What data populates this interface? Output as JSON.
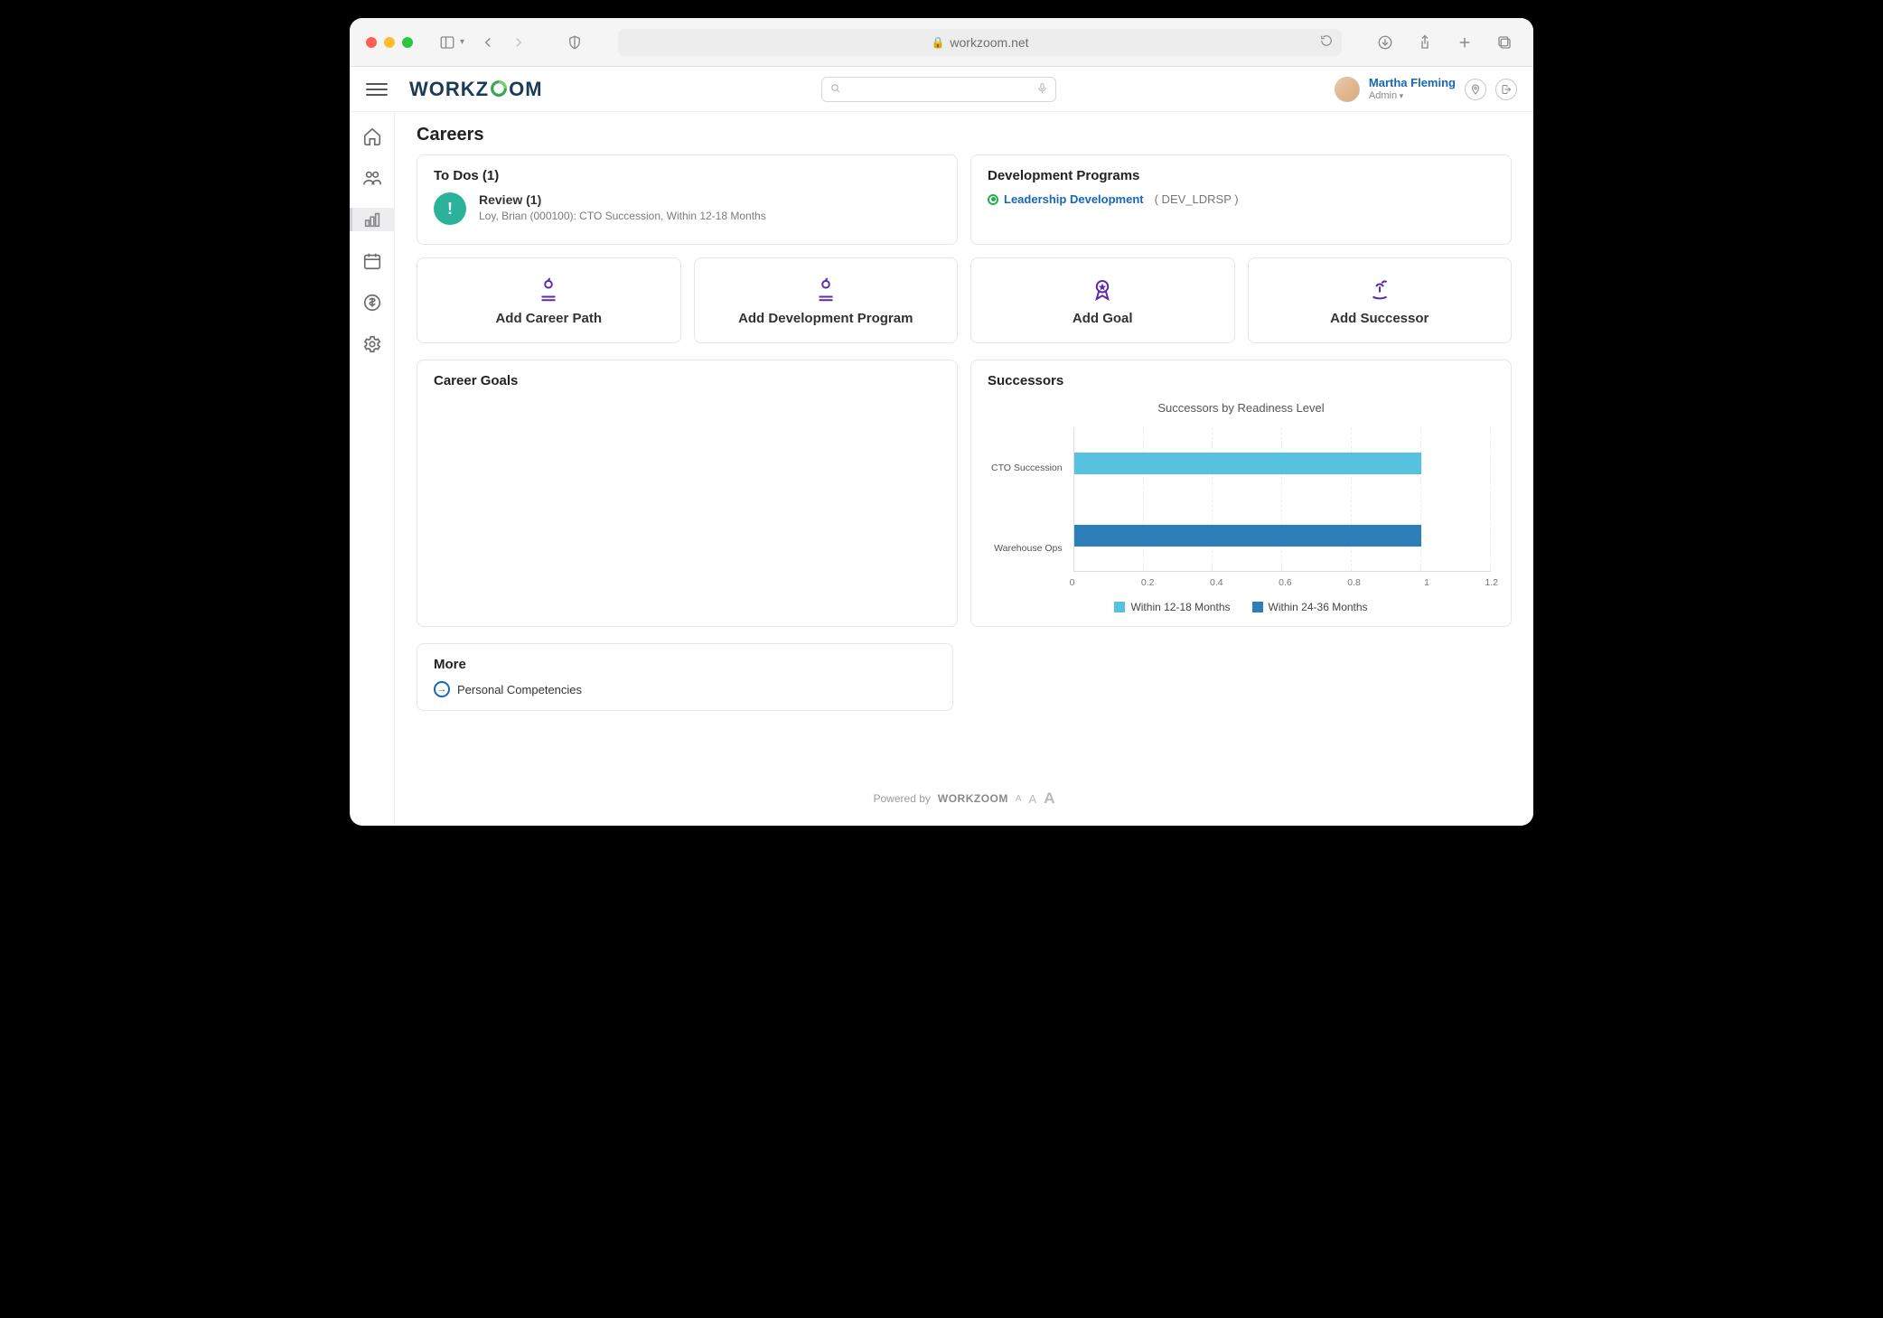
{
  "browser": {
    "url": "workzoom.net"
  },
  "brand": {
    "name": "WORKZOOM",
    "prefix": "WORKZ",
    "accent_letter": "O",
    "suffix": "OM"
  },
  "user": {
    "name": "Martha Fleming",
    "role": "Admin"
  },
  "page": {
    "title": "Careers"
  },
  "todos": {
    "heading": "To Dos (1)",
    "items": [
      {
        "title": "Review (1)",
        "subtitle": "Loy, Brian (000100): CTO Succession, Within 12-18 Months",
        "badge": "!"
      }
    ]
  },
  "dev_programs": {
    "heading": "Development Programs",
    "items": [
      {
        "name": "Leadership Development",
        "code": "( DEV_LDRSP )"
      }
    ]
  },
  "actions": [
    {
      "id": "add-career-path",
      "label": "Add Career Path"
    },
    {
      "id": "add-development-program",
      "label": "Add Development Program"
    },
    {
      "id": "add-goal",
      "label": "Add Goal"
    },
    {
      "id": "add-successor",
      "label": "Add Successor"
    }
  ],
  "career_goals": {
    "heading": "Career Goals"
  },
  "successors": {
    "heading": "Successors"
  },
  "more": {
    "heading": "More",
    "link": "Personal Competencies"
  },
  "footer": {
    "prefix": "Powered by",
    "brand": "WORKZOOM"
  },
  "chart_data": {
    "type": "bar",
    "orientation": "horizontal",
    "title": "Successors by Readiness Level",
    "categories": [
      "CTO Succession",
      "Warehouse Ops"
    ],
    "series": [
      {
        "name": "Within 12-18 Months",
        "values": [
          1,
          0
        ],
        "color": "#57c2df"
      },
      {
        "name": "Within 24-36 Months",
        "values": [
          0,
          1
        ],
        "color": "#2c7fb8"
      }
    ],
    "xlim": [
      0,
      1.2
    ],
    "x_ticks": [
      0,
      0.2,
      0.4,
      0.6,
      0.8,
      1,
      1.2
    ],
    "xlabel": "",
    "ylabel": ""
  }
}
